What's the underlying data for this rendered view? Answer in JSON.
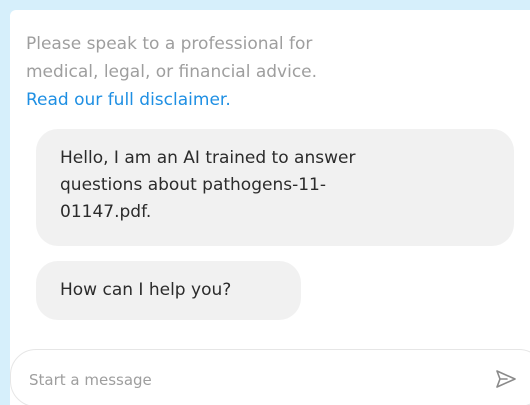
{
  "disclaimer": {
    "line1": "Please speak to a professional for",
    "line2": "medical, legal, or financial advice.",
    "link_label": "Read our full disclaimer."
  },
  "messages": [
    {
      "line1": "Hello, I am an AI trained to answer",
      "line2": "questions about pathogens-11-",
      "line3": "01147.pdf."
    },
    {
      "line1": "How can I help you?"
    }
  ],
  "composer": {
    "placeholder": "Start a message",
    "value": "",
    "send_icon": "send-icon"
  },
  "colors": {
    "page_background": "#d6effb",
    "panel_background": "#ffffff",
    "bubble_background": "#f1f1f1",
    "link": "#1e8fe3",
    "muted_text": "#9e9e9e"
  }
}
